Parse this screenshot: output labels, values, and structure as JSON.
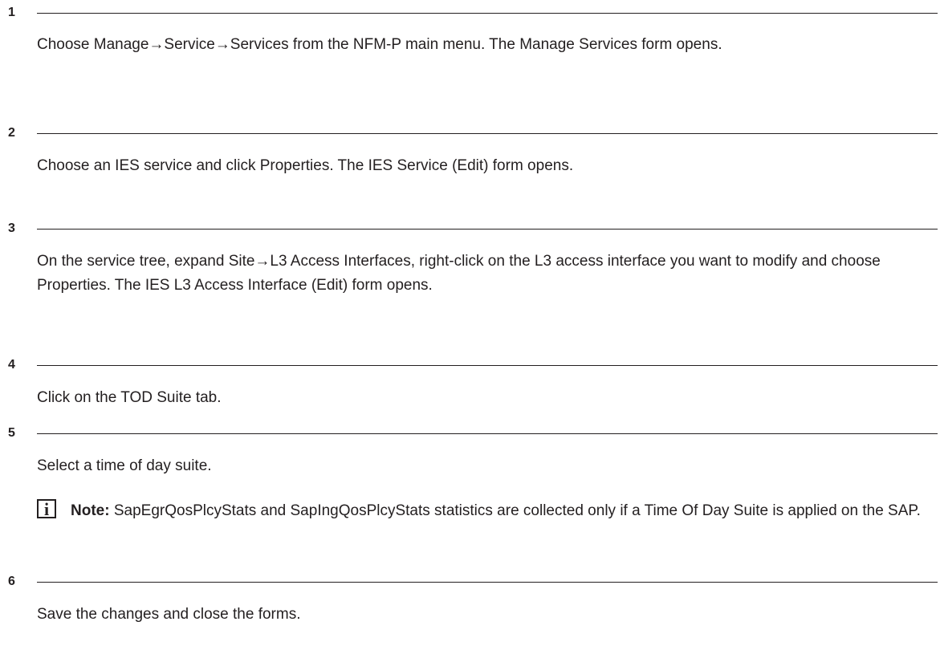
{
  "steps": [
    {
      "number": "1",
      "text": "Choose Manage→Service→Services from the NFM-P main menu. The Manage Services form opens."
    },
    {
      "number": "2",
      "text": "Choose an IES service and click Properties. The IES Service (Edit) form opens."
    },
    {
      "number": "3",
      "text": "On the service tree, expand Site→L3 Access Interfaces, right-click on the L3 access interface you want to modify and choose Properties. The IES L3 Access Interface (Edit) form opens."
    },
    {
      "number": "4",
      "text": "Click on the TOD Suite tab."
    },
    {
      "number": "5",
      "text": "Select a time of day suite."
    },
    {
      "number": "6",
      "text": "Save the changes and close the forms."
    }
  ],
  "note": {
    "icon": "info-icon",
    "icon_glyph": "i",
    "label": "Note:",
    "text": "SapEgrQosPlcyStats and SapIngQosPlcyStats statistics are collected only if a Time Of Day Suite is applied on the SAP."
  }
}
